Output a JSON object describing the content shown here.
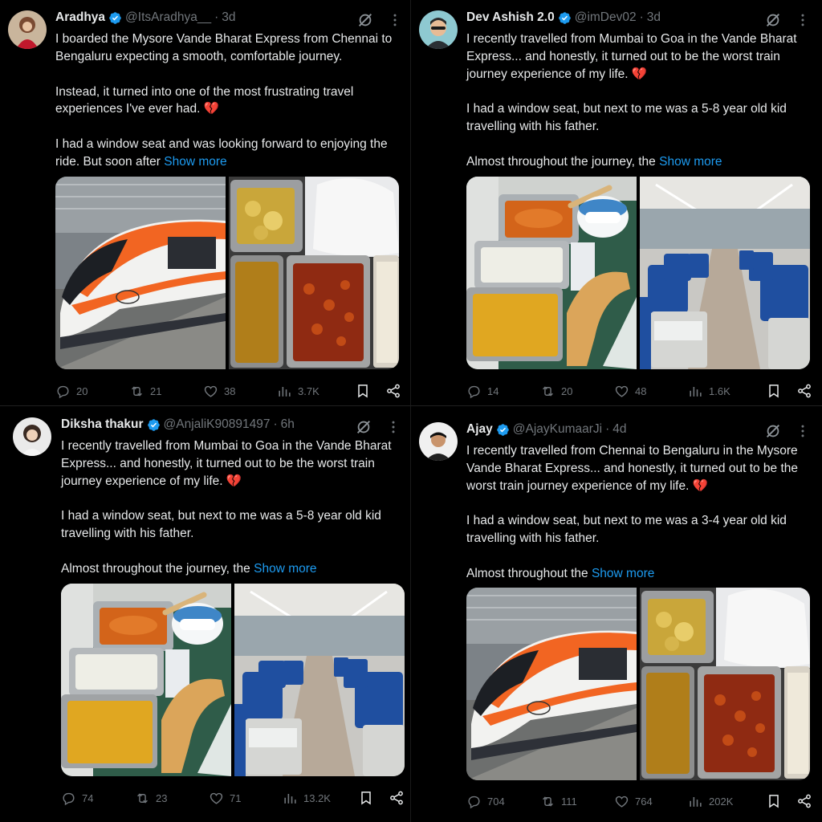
{
  "colors": {
    "background": "#000000",
    "text": "#e7e9ea",
    "muted": "#71767b",
    "link": "#1d9bf0",
    "verified": "#1d9bf0",
    "heart_emoji": "#e0245e"
  },
  "icons": {
    "verified": "verified-badge-icon",
    "grok": "grok-icon",
    "more": "more-icon",
    "reply": "reply-icon",
    "retweet": "retweet-icon",
    "like": "heart-icon",
    "views": "views-icon",
    "bookmark": "bookmark-icon",
    "share": "share-icon"
  },
  "tweets": [
    {
      "name": "Aradhya",
      "handle": "@ItsAradhya__",
      "sep": "·",
      "time": "3d",
      "p1": "I boarded the Mysore Vande Bharat Express from Chennai to Bengaluru expecting a smooth, comfortable journey.",
      "p2": "Instead, it turned into one of the most frustrating travel experiences I've ever had. 💔",
      "p3": "I had a window seat and was looking forward to enjoying the ride. But soon after",
      "show_more": "Show more",
      "media_left": "train",
      "media_right": "food-trays",
      "replies": "20",
      "retweets": "21",
      "likes": "38",
      "views": "3.7K"
    },
    {
      "name": "Dev Ashish 2.0",
      "handle": "@imDev02",
      "sep": "·",
      "time": "3d",
      "p1": "I recently travelled from Mumbai to Goa in the Vande Bharat Express... and honestly, it turned out to be the worst train journey experience of my life. 💔",
      "p2": "I had a window seat, but next to me was a 5-8 year old kid travelling with his father.",
      "p3": "Almost throughout the journey, the",
      "show_more": "Show more",
      "media_left": "meal-tray",
      "media_right": "coach-interior",
      "replies": "14",
      "retweets": "20",
      "likes": "48",
      "views": "1.6K"
    },
    {
      "name": "Diksha thakur",
      "handle": "@AnjaliK90891497",
      "sep": "·",
      "time": "6h",
      "p1": "I recently travelled from Mumbai to Goa in the Vande Bharat Express... and honestly, it turned out to be the worst train journey experience of my life. 💔",
      "p2": "I had a window seat, but next to me was a 5-8 year old kid travelling with his father.",
      "p3": "Almost throughout the journey, the",
      "show_more": "Show more",
      "media_left": "meal-tray",
      "media_right": "coach-interior",
      "replies": "74",
      "retweets": "23",
      "likes": "71",
      "views": "13.2K"
    },
    {
      "name": "Ajay",
      "handle": "@AjayKumaarJi",
      "sep": "·",
      "time": "4d",
      "p1": "I recently travelled from Chennai to Bengaluru in the Mysore Vande Bharat Express... and honestly, it turned out to be the worst train journey experience of my life. 💔",
      "p2": "I had a window seat, but next to me was a 3-4 year old kid travelling with his father.",
      "p3": "Almost throughout the",
      "show_more": "Show more",
      "media_left": "train",
      "media_right": "food-trays",
      "replies": "704",
      "retweets": "111",
      "likes": "764",
      "views": "202K"
    }
  ]
}
